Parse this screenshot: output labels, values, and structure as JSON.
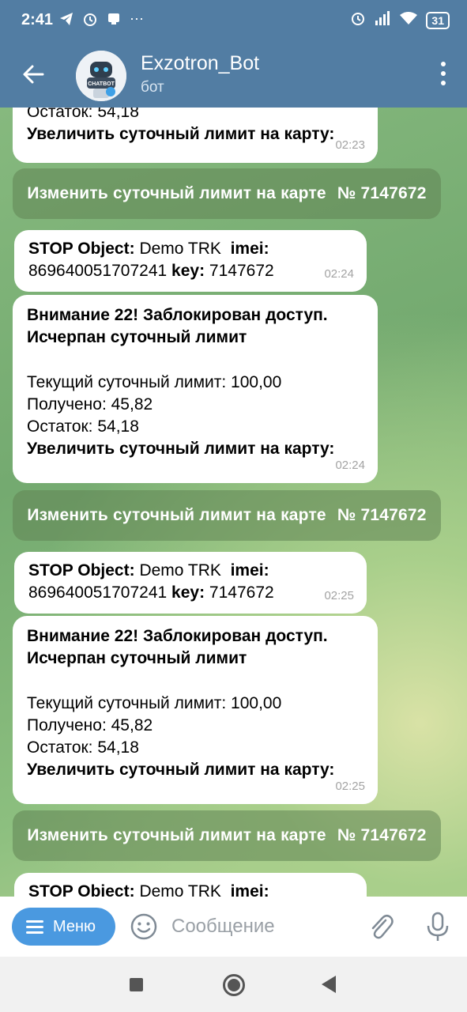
{
  "status": {
    "time": "2:41",
    "battery": "31"
  },
  "header": {
    "title": "Exzotron_Bot",
    "subtitle": "бот",
    "avatar_label": "CHATBOT"
  },
  "messages": {
    "first_partial": {
      "line_cut": "Остаток: 54,18",
      "line_last": "Увеличить суточный лимит на карту:",
      "time": "02:23"
    },
    "keyboard_button": {
      "text": "Изменить суточный лимит на карте",
      "number": "№ 7147672"
    },
    "stop": {
      "label1": "STOP Object:",
      "val1": "Demo TRK",
      "label2": "imei:",
      "val2": "869640051707241",
      "label3": "key:",
      "val3": "7147672"
    },
    "alert": {
      "line1": "Внимание 22! Заблокирован доступ.",
      "line2": "Исчерпан суточный лимит",
      "limit": "Текущий суточный лимит: 100,00",
      "received": "Получено: 45,82",
      "remain": "Остаток: 54,18",
      "increase": "Увеличить суточный лимит на карту:"
    },
    "times": {
      "stop1": "02:24",
      "alert1": "02:24",
      "stop2": "02:25",
      "alert2": "02:25"
    }
  },
  "composer": {
    "menu_label": "Меню",
    "placeholder": "Сообщение"
  }
}
